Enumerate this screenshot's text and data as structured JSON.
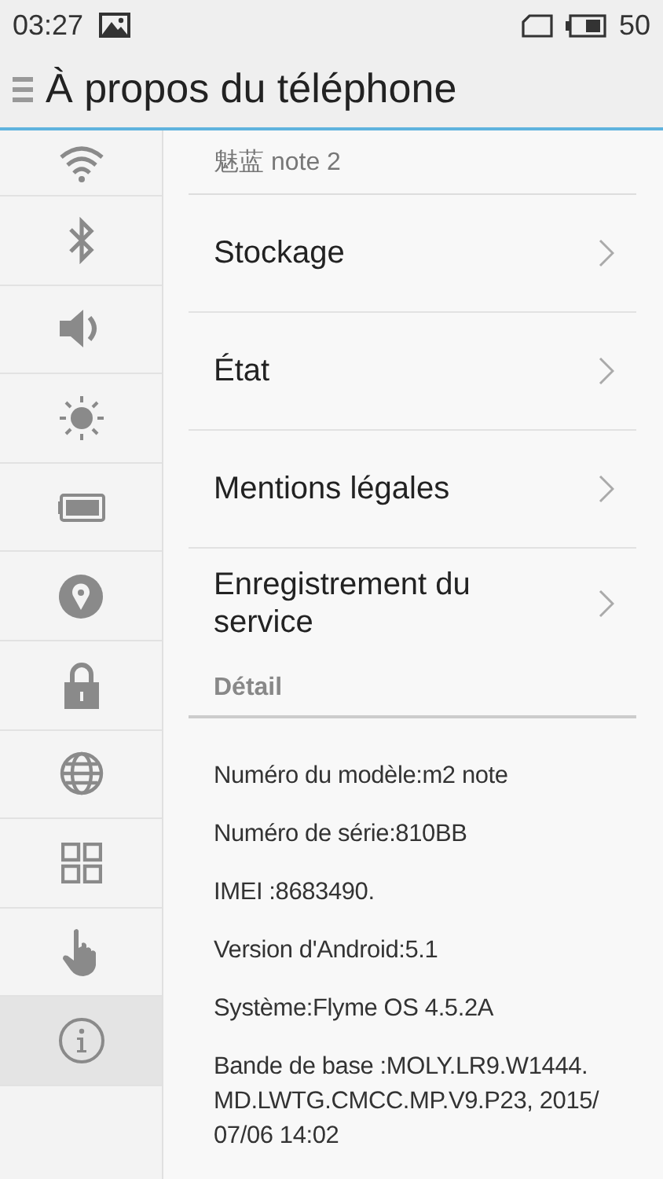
{
  "status_bar": {
    "time": "03:27",
    "battery_text": "50"
  },
  "header": {
    "title": "À propos du téléphone"
  },
  "sidebar": {
    "items": [
      {
        "kind": "wifi",
        "selected": false
      },
      {
        "kind": "bluetooth",
        "selected": false
      },
      {
        "kind": "sound",
        "selected": false
      },
      {
        "kind": "brightness",
        "selected": false
      },
      {
        "kind": "battery",
        "selected": false
      },
      {
        "kind": "location",
        "selected": false
      },
      {
        "kind": "lock",
        "selected": false
      },
      {
        "kind": "globe",
        "selected": false
      },
      {
        "kind": "apps",
        "selected": false
      },
      {
        "kind": "hand",
        "selected": false
      },
      {
        "kind": "info",
        "selected": true
      }
    ]
  },
  "device_name": "魅蓝 note 2",
  "menu_rows": [
    {
      "label": "Stockage"
    },
    {
      "label": "État"
    },
    {
      "label": "Mentions légales"
    },
    {
      "label": "Enregistrement du service"
    }
  ],
  "section_title": "Détail",
  "details": [
    "Numéro du modèle:m2 note",
    "Numéro de série:810BB",
    "IMEI :8683490.",
    "Version d'Android:5.1",
    "Système:Flyme OS 4.5.2A",
    "Bande de base :MOLY.LR9.W1444. MD.LWTG.CMCC.MP.V9.P23, 2015/ 07/06 14:02"
  ]
}
